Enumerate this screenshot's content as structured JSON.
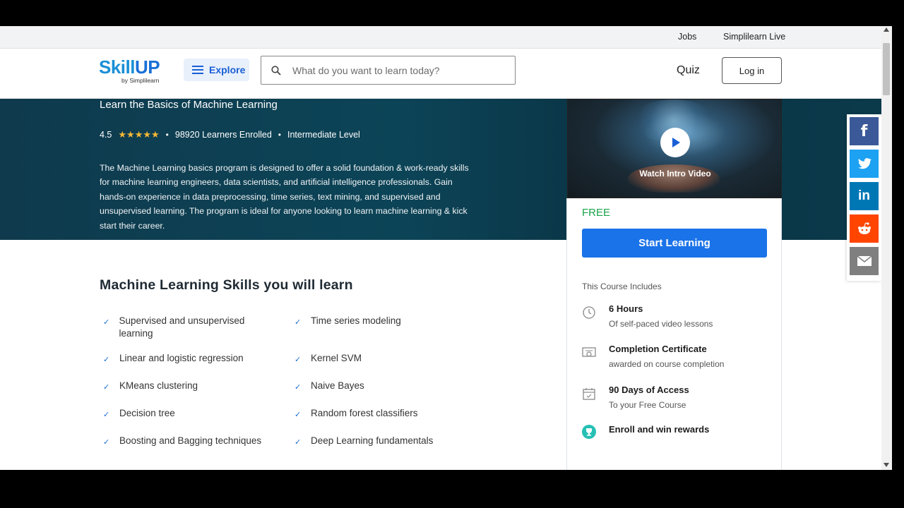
{
  "topbar": {
    "jobs": "Jobs",
    "live": "Simplilearn Live"
  },
  "header": {
    "logo_brand": "Skill",
    "logo_up": "UP",
    "logo_sub": "by Simplilearn",
    "explore_label": "Explore",
    "search_placeholder": "What do you want to learn today?",
    "quiz": "Quiz",
    "login": "Log in"
  },
  "hero": {
    "tagline": "Learn the Basics of Machine Learning",
    "rating": "4.5",
    "stars": "★★★★★",
    "learners": "98920 Learners Enrolled",
    "level": "Intermediate Level",
    "description": "The Machine Learning basics program is designed to offer a solid foundation & work-ready skills for machine learning engineers, data scientists, and artificial intelligence professionals. Gain hands-on experience in data preprocessing, time series, text mining, and supervised and unsupervised learning. The program is ideal for anyone looking to learn machine learning & kick start their career."
  },
  "video": {
    "label": "Watch Intro Video"
  },
  "card": {
    "price": "FREE",
    "cta": "Start Learning",
    "includes_title": "This Course Includes",
    "items": [
      {
        "title": "6 Hours",
        "sub": "Of self-paced video lessons",
        "icon": "clock-icon"
      },
      {
        "title": "Completion Certificate",
        "sub": "awarded on course completion",
        "icon": "certificate-icon"
      },
      {
        "title": "90 Days of Access",
        "sub": "To your Free Course",
        "icon": "calendar-icon"
      },
      {
        "title": "Enroll and win rewards",
        "sub": "",
        "icon": "trophy-icon"
      }
    ]
  },
  "skills": {
    "title": "Machine Learning Skills you will learn",
    "left": [
      "Supervised and unsupervised learning",
      "Linear and logistic regression",
      "KMeans clustering",
      "Decision tree",
      "Boosting and Bagging techniques"
    ],
    "right": [
      "Time series modeling",
      "Kernel SVM",
      "Naive Bayes",
      "Random forest classifiers",
      "Deep Learning fundamentals"
    ]
  },
  "share": {
    "facebook": "f",
    "linkedin": "in",
    "colors": {
      "facebook": "#3b5998",
      "twitter": "#1da1f2",
      "linkedin": "#0077b5",
      "reddit": "#ff4500",
      "email": "#7f7f7f"
    }
  }
}
